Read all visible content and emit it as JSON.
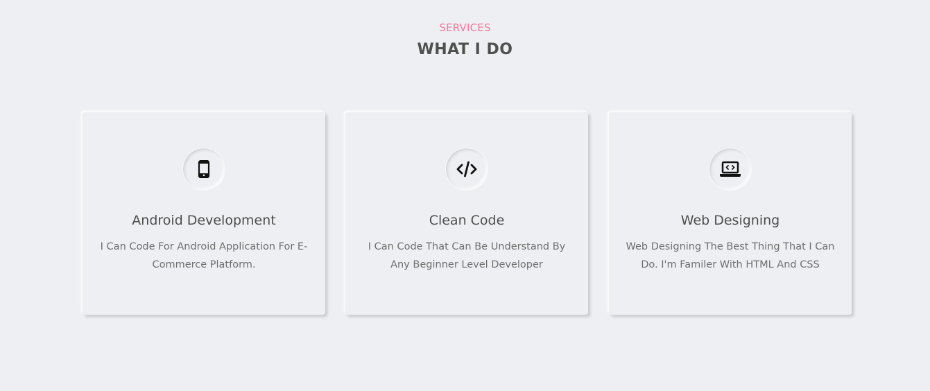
{
  "header": {
    "eyebrow": "SERVICES",
    "title": "WHAT I DO"
  },
  "colors": {
    "background": "#eeeff3",
    "accent": "#f27a97",
    "heading": "#505050",
    "body_text": "#6f6f6f"
  },
  "services": [
    {
      "icon": "mobile-phone-icon",
      "title": "Android Development",
      "description": "I Can Code For Android Application For E-Commerce Platform."
    },
    {
      "icon": "code-icon",
      "title": "Clean Code",
      "description": "I Can Code That Can Be Understand By Any Beginner Level Developer"
    },
    {
      "icon": "laptop-code-icon",
      "title": "Web Designing",
      "description": "Web Designing The Best Thing That I Can Do. I'm Familer With HTML And CSS"
    }
  ]
}
